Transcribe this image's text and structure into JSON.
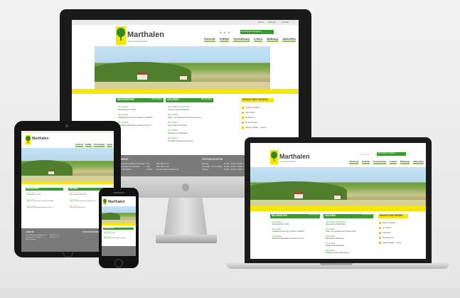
{
  "site": {
    "brand_name": "Marthalen",
    "tagline": "Gemeinde Marthalen",
    "top_links": [
      "Home",
      "Sitemap",
      "Kontakt"
    ],
    "search_placeholder": "Suchbegriff eingeben ...",
    "nav": [
      "Portrait",
      "Politik",
      "Verwaltung",
      "Leben",
      "Bildung",
      "Aktuelles"
    ],
    "news_title": "NEUIGKEITEN",
    "events_title": "ANLÄSSE",
    "services_title": "DIENSTLEISTUNGEN",
    "more_label": "alle anzeigen",
    "news_items": [
      {
        "date": "01.12.2014",
        "text": "Bürgerblatt Nr. 2013"
      },
      {
        "date": "01.12.2014",
        "text": "Altpapiersammlung im Winter erhältlich"
      },
      {
        "date": "01.12.2014",
        "text": "Bibliothek Marthalen Ausleihe 2014 ??"
      }
    ],
    "event_items": [
      {
        "date": "04.12.2014 · 04.12.2014",
        "text": "Adventsmarkt Marthalen"
      },
      {
        "date": "05.12.2014",
        "text": "Spiel- und Jassabend Kirchgemeinde"
      },
      {
        "date": "06.12.2014",
        "text": "Samichlaus Marthalen"
      },
      {
        "date": "07.12.2014",
        "text": "Musikverein Marthalen"
      },
      {
        "date": "08.12.2014",
        "text": "Kirchgemeindeversammlung"
      }
    ],
    "service_items": [
      "Online-Schalter",
      "Formulare",
      "Gebühren",
      "Primarschule",
      "Offene Stellen - Kurse"
    ],
    "footer": {
      "address_title": "ADRESSE",
      "address_lines": [
        "Gemeindeverwaltung Marthalen",
        "Landstrasse 51, Postfach",
        "8460 Marthalen"
      ],
      "contact_labels": [
        "Tel.",
        "Fax",
        "E-Mail"
      ],
      "contact_values": [
        "052 305 11 11",
        "052 305 11 12",
        "gemeinde@marthalen.ch"
      ],
      "hours_title": "ÖFFNUNGSZEITEN",
      "hours_days": [
        "Montag",
        "Dienstag - Donnerstag",
        "Freitag"
      ],
      "hours_times": [
        "07:30 - 11:30 / 14:00 - 18:30",
        "07:30 - 11:30 / 14:00 - 16:30",
        "07:30 - 11:30 / 14:00 - 16:00"
      ]
    }
  }
}
